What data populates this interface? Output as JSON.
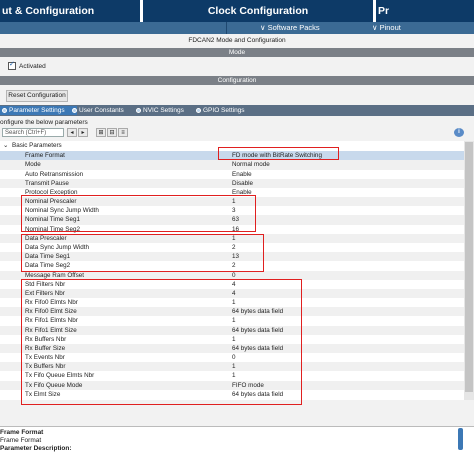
{
  "tabs": {
    "pinout_configuration": "ut & Configuration",
    "clock_configuration": "Clock Configuration",
    "project_manager": "Pr"
  },
  "subbar": {
    "software_packs": "Software Packs",
    "pinout": "Pinout"
  },
  "panel_title": "FDCAN2 Mode and Configuration",
  "mode_header": "Mode",
  "activated_label": "Activated",
  "configuration_header": "Configuration",
  "reset_button": "Reset Configuration",
  "config_tabs": {
    "parameter_settings": "Parameter Settings",
    "user_constants": "User Constants",
    "nvic_settings": "NVIC Settings",
    "gpio_settings": "GPIO Settings"
  },
  "configure_text": "onfigure the below parameters",
  "search_placeholder": "Search (Ctrl+F)",
  "info_glyph": "i",
  "group_label": "Basic Parameters",
  "parameters": [
    {
      "name": "Frame Format",
      "value": "FD mode with BitRate Switching"
    },
    {
      "name": "Mode",
      "value": "Normal mode"
    },
    {
      "name": "Auto Retransmission",
      "value": "Enable"
    },
    {
      "name": "Transmit Pause",
      "value": "Disable"
    },
    {
      "name": "Protocol Exception",
      "value": "Enable"
    },
    {
      "name": "Nominal Prescaler",
      "value": "1"
    },
    {
      "name": "Nominal Sync Jump Width",
      "value": "3"
    },
    {
      "name": "Nominal Time Seg1",
      "value": "63"
    },
    {
      "name": "Nominal Time Seg2",
      "value": "16"
    },
    {
      "name": "Data Prescaler",
      "value": "1"
    },
    {
      "name": "Data Sync Jump Width",
      "value": "2"
    },
    {
      "name": "Data Time Seg1",
      "value": "13"
    },
    {
      "name": "Data Time Seg2",
      "value": "2"
    },
    {
      "name": "Message Ram Offset",
      "value": "0"
    },
    {
      "name": "Std Filters Nbr",
      "value": "4"
    },
    {
      "name": "Ext Filters Nbr",
      "value": "4"
    },
    {
      "name": "Rx Fifo0 Elmts Nbr",
      "value": "1"
    },
    {
      "name": "Rx Fifo0 Elmt Size",
      "value": "64 bytes data field"
    },
    {
      "name": "Rx Fifo1 Elmts Nbr",
      "value": "1"
    },
    {
      "name": "Rx Fifo1 Elmt Size",
      "value": "64 bytes data field"
    },
    {
      "name": "Rx Buffers Nbr",
      "value": "1"
    },
    {
      "name": "Rx Buffer Size",
      "value": "64 bytes data field"
    },
    {
      "name": "Tx Events Nbr",
      "value": "0"
    },
    {
      "name": "Tx Buffers Nbr",
      "value": "1"
    },
    {
      "name": "Tx Fifo Queue Elmts Nbr",
      "value": "1"
    },
    {
      "name": "Tx Fifo Queue Mode",
      "value": "FIFO mode"
    },
    {
      "name": "Tx Elmt Size",
      "value": "64 bytes data field"
    }
  ],
  "description": {
    "line1": "Frame Format",
    "line2": "Frame Format",
    "line3": "Parameter Description:"
  },
  "colors": {
    "tab_bg": "#0d3a67",
    "highlight_box": "#e02020"
  }
}
